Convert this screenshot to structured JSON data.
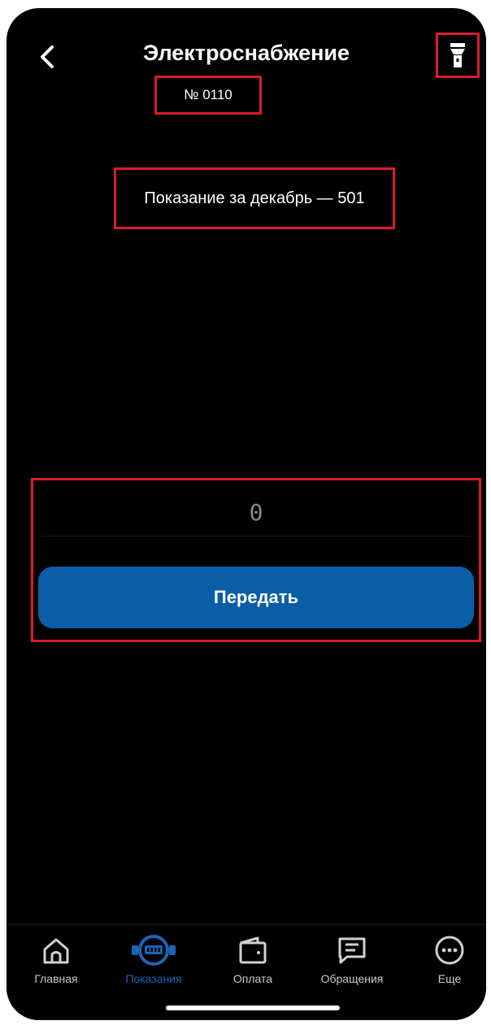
{
  "header": {
    "title": "Электроснабжение",
    "meter_number": "№ 0110"
  },
  "reading": {
    "text": "Показание за декабрь — 501"
  },
  "form": {
    "input_value": "0",
    "submit_label": "Передать"
  },
  "tabbar": {
    "tabs": [
      {
        "label": "Главная",
        "icon": "home-icon"
      },
      {
        "label": "Показания",
        "icon": "meter-icon",
        "active": true
      },
      {
        "label": "Оплата",
        "icon": "wallet-icon"
      },
      {
        "label": "Обращения",
        "icon": "chat-icon"
      },
      {
        "label": "Еще",
        "icon": "more-icon"
      }
    ]
  },
  "colors": {
    "background": "#000000",
    "accent": "#0a5ea8",
    "highlight": "#d81e2a"
  }
}
